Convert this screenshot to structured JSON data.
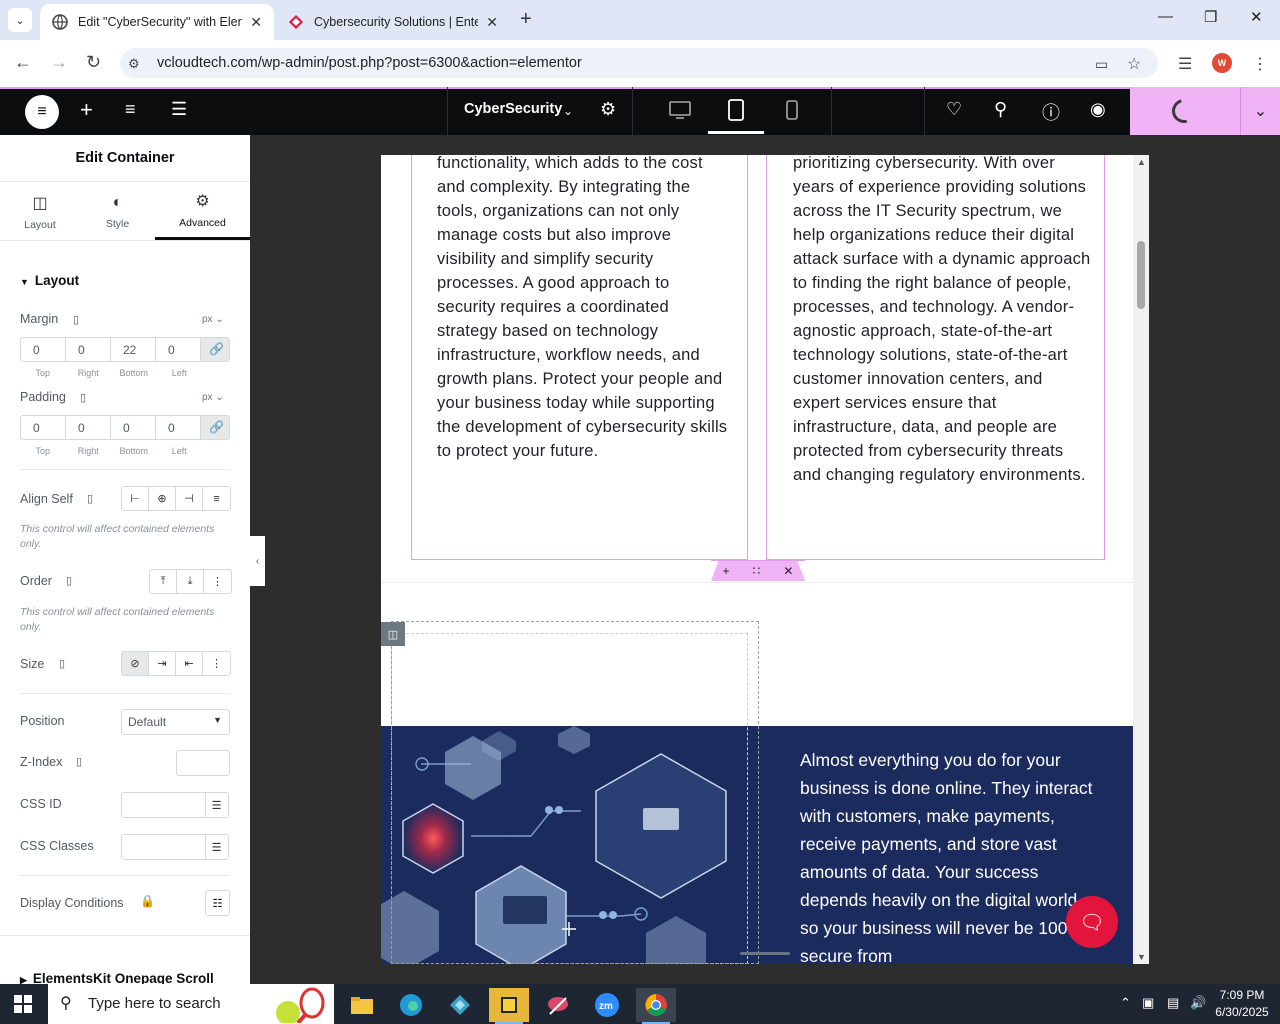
{
  "browser": {
    "tabs": [
      {
        "title": "Edit \"CyberSecurity\" with Eleme",
        "active": true
      },
      {
        "title": "Cybersecurity Solutions | Enterp",
        "active": false
      }
    ],
    "url": "vcloudtech.com/wp-admin/post.php?post=6300&action=elementor",
    "profile_initial": "W"
  },
  "topbar": {
    "page_name": "CyberSecurity",
    "active_device": "tablet"
  },
  "panel": {
    "title": "Edit Container",
    "tabs": [
      {
        "label": "Layout",
        "icon": "layout-icon"
      },
      {
        "label": "Style",
        "icon": "style-icon"
      },
      {
        "label": "Advanced",
        "icon": "gear-icon",
        "active": true
      }
    ],
    "section_title": "Layout",
    "margin": {
      "label": "Margin",
      "unit": "px",
      "values": [
        "0",
        "0",
        "22",
        "0"
      ]
    },
    "padding": {
      "label": "Padding",
      "unit": "px",
      "values": [
        "0",
        "0",
        "0",
        "0"
      ]
    },
    "sides": [
      "Top",
      "Right",
      "Bottom",
      "Left"
    ],
    "align_self": "Align Self",
    "order": "Order",
    "hint": "This control will affect contained elements only.",
    "size": "Size",
    "position": {
      "label": "Position",
      "value": "Default"
    },
    "z_index": "Z-Index",
    "css_id": "CSS ID",
    "css_classes": "CSS Classes",
    "display_conditions": "Display Conditions",
    "next_section": "ElementsKit Onepage Scroll"
  },
  "canvas": {
    "col1_text": "functionality, which adds to the cost and complexity. By integrating the tools, organizations can not only manage costs but also improve visibility and simplify security processes. A good approach to security requires a coordinated strategy based on technology infrastructure, workflow needs, and growth plans. Protect your people and your business today while supporting the development of cybersecurity skills to protect your future.",
    "col2_text": "prioritizing cybersecurity. With over years of experience providing solutions across the IT Security spectrum, we help organizations reduce their digital attack surface with a dynamic approach to finding the right balance of people, processes, and technology. A vendor-agnostic approach, state-of-the-art technology solutions, state-of-the-art customer innovation centers, and expert services ensure that infrastructure, data, and people are protected from cybersecurity threats and changing regulatory environments.",
    "band_text": "Almost everything you do for your business is done online. They interact with customers, make payments, receive payments, and store vast amounts of data. Your success depends heavily on the digital world, so your business will never be 100% secure from"
  },
  "taskbar": {
    "search_placeholder": "Type here to search",
    "time": "7:09 PM",
    "date": "6/30/2025"
  }
}
